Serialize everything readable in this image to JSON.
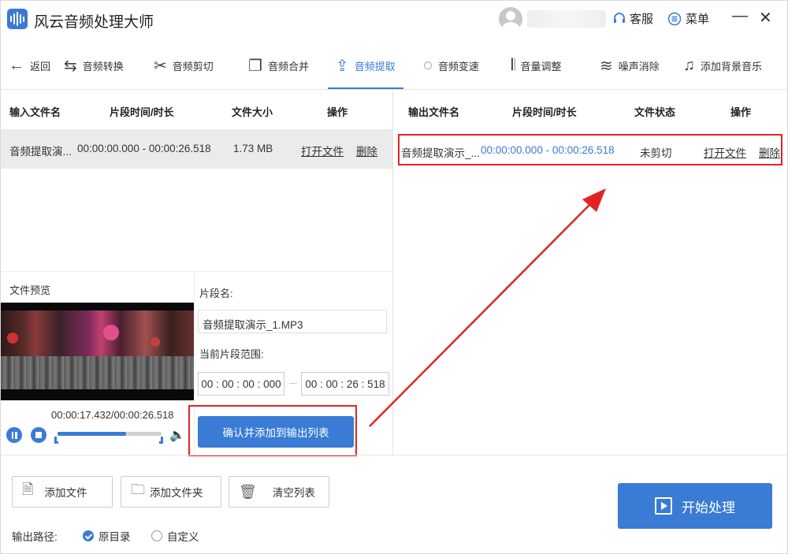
{
  "app": {
    "title": "风云音频处理大师"
  },
  "header": {
    "service_label": "客服",
    "menu_label": "菜单",
    "minimize": "—",
    "close": "✕"
  },
  "toolbar": {
    "items": [
      {
        "label": "返回",
        "icon": "back-arrow-icon"
      },
      {
        "label": "音频转换",
        "icon": "convert-icon"
      },
      {
        "label": "音频剪切",
        "icon": "scissors-icon"
      },
      {
        "label": "音频合并",
        "icon": "merge-icon"
      },
      {
        "label": "音频提取",
        "icon": "upload-icon",
        "active": true
      },
      {
        "label": "音频变速",
        "icon": "speed-icon"
      },
      {
        "label": "音量调整",
        "icon": "volume-bars-icon"
      },
      {
        "label": "噪声消除",
        "icon": "noise-icon"
      },
      {
        "label": "添加背景音乐",
        "icon": "music-note-icon"
      }
    ]
  },
  "input_table": {
    "headers": [
      "输入文件名",
      "片段时间/时长",
      "文件大小",
      "操作"
    ],
    "rows": [
      {
        "filename": "音频提取演...",
        "time_range": "00:00:00.000 - 00:00:26.518",
        "size": "1.73 MB",
        "open": "打开文件",
        "delete": "删除"
      }
    ]
  },
  "output_table": {
    "headers": [
      "输出文件名",
      "片段时间/时长",
      "文件状态",
      "操作"
    ],
    "rows": [
      {
        "filename": "音频提取演示_...",
        "time_range": "00:00:00.000 - 00:00:26.518",
        "status": "未剪切",
        "open": "打开文件",
        "delete": "删除"
      }
    ]
  },
  "preview": {
    "label": "文件预览",
    "time_readout": "00:00:17.432/00:00:26.518",
    "progress": 0.657
  },
  "segment": {
    "name_label": "片段名:",
    "name_value": "音频提取演示_1.MP3",
    "range_label": "当前片段范围:",
    "start_time": "00 : 00 : 00 : 000",
    "end_time": "00 : 00 : 26 : 518",
    "confirm_label": "确认并添加到输出列表"
  },
  "bottom": {
    "add_file": "添加文件",
    "add_folder": "添加文件夹",
    "clear_list": "清空列表",
    "output_path_label": "输出路径:",
    "option_original": "原目录",
    "option_custom": "自定义",
    "start_label": "开始处理"
  },
  "colors": {
    "accent": "#3a7bd5",
    "highlight": "#e02424"
  }
}
